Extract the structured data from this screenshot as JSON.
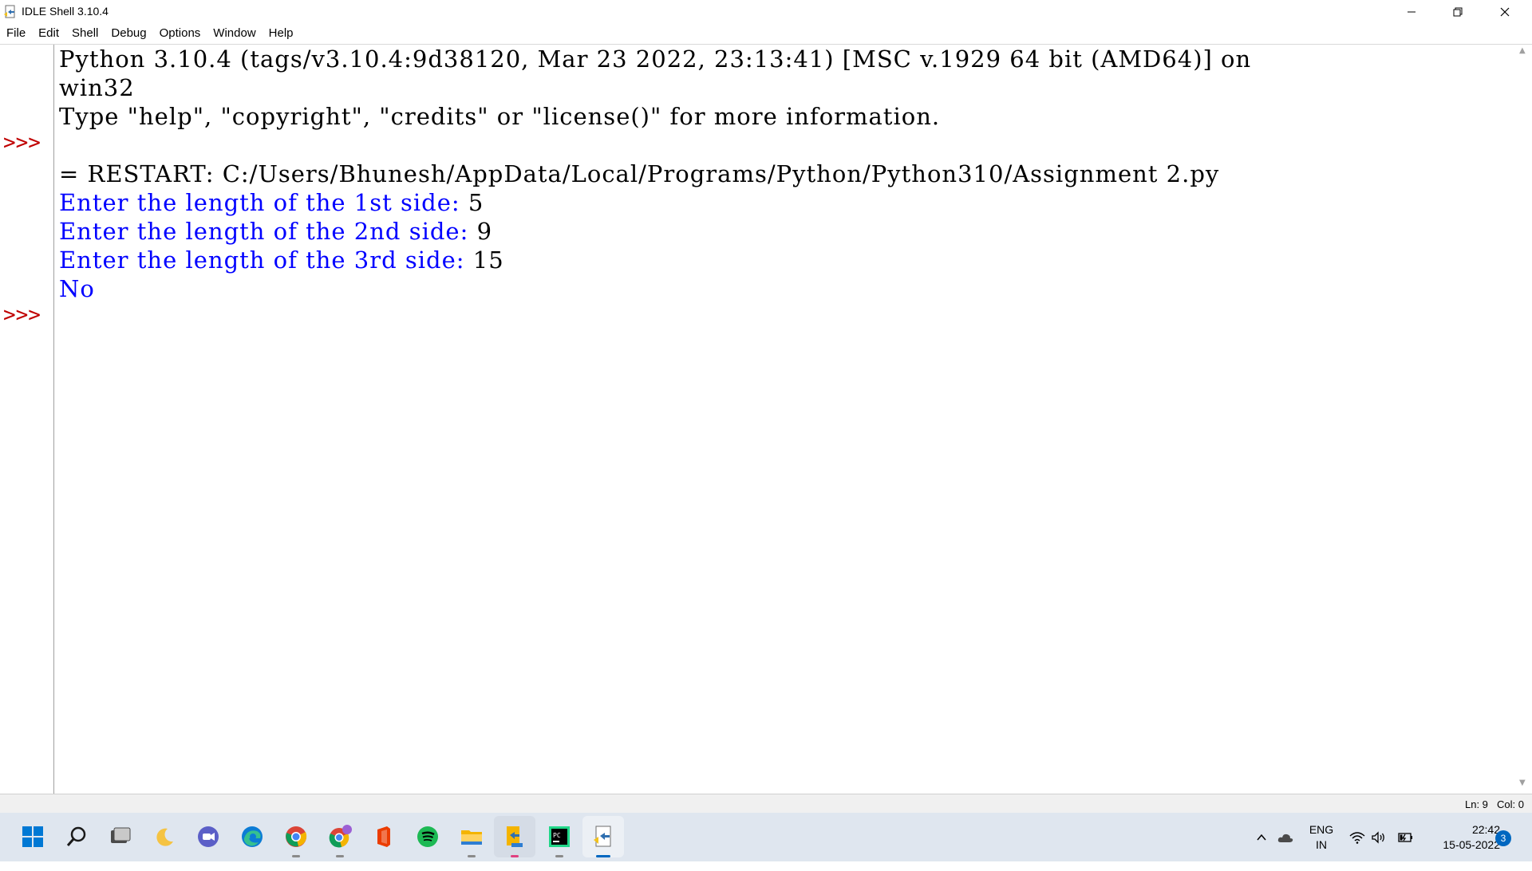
{
  "window": {
    "title": "IDLE Shell 3.10.4",
    "controls": {
      "minimize": "—",
      "maximize": "❐",
      "close": "✕"
    }
  },
  "menu": {
    "items": [
      "File",
      "Edit",
      "Shell",
      "Debug",
      "Options",
      "Window",
      "Help"
    ]
  },
  "shell": {
    "prompt": ">>>",
    "lines": [
      {
        "text": "Python 3.10.4 (tags/v3.10.4:9d38120, Mar 23 2022, 23:13:41) [MSC v.1929 64 bit (AMD64)] on"
      },
      {
        "text": "win32"
      },
      {
        "text": "Type \"help\", \"copyright\", \"credits\" or \"license()\" for more information."
      },
      {
        "text": ""
      },
      {
        "text": "= RESTART: C:/Users/Bhunesh/AppData/Local/Programs/Python/Python310/Assignment 2.py"
      },
      {
        "prompt": "Enter the length of the 1st side: ",
        "input": "5"
      },
      {
        "prompt": "Enter the length of the 2nd side: ",
        "input": "9"
      },
      {
        "prompt": "Enter the length of the 3rd side: ",
        "input": "15"
      },
      {
        "output": "No"
      }
    ]
  },
  "statusbar": {
    "line": "Ln: 9",
    "col": "Col: 0"
  },
  "taskbar": {
    "icons": [
      "windows-start-icon",
      "search-icon",
      "task-view-icon",
      "widgets-icon",
      "teams-chat-icon",
      "edge-icon",
      "chrome-icon",
      "chrome-profile-icon",
      "office-icon",
      "spotify-icon",
      "file-explorer-icon",
      "idle-files-icon",
      "pycharm-icon",
      "idle-shell-icon"
    ],
    "tray": {
      "lang_line1": "ENG",
      "lang_line2": "IN",
      "time": "22:42",
      "date": "15-05-2022",
      "notifications": "3"
    }
  },
  "colors": {
    "prompt": "#c00000",
    "stdout": "#0000ff",
    "stdin": "#000000",
    "taskbar_bg": "#dfe6ef"
  }
}
